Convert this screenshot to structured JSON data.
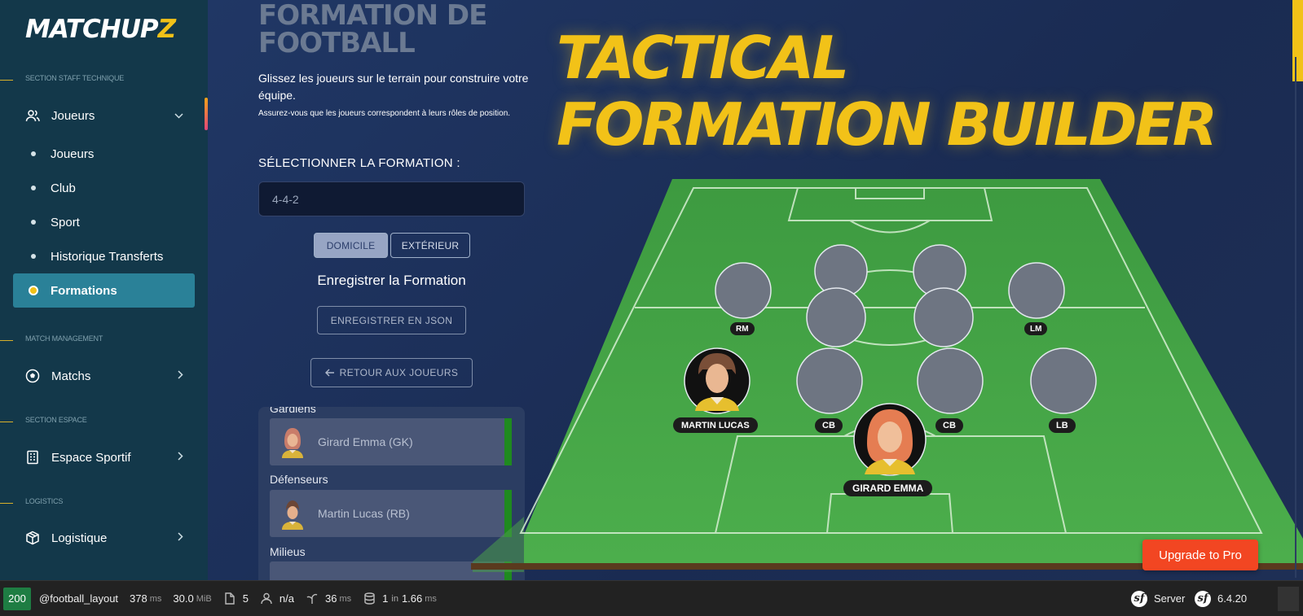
{
  "app": {
    "logo": "MATCHUP",
    "logo_accent": "Z"
  },
  "sidebar": {
    "sections": [
      {
        "label": "SECTION STAFF TECHNIQUE"
      },
      {
        "label": "MATCH MANAGEMENT"
      },
      {
        "label": "SECTION ESPACE"
      },
      {
        "label": "LOGISTICS"
      }
    ],
    "joueurs": {
      "label": "Joueurs",
      "icon": "users-icon"
    },
    "sub_items": [
      {
        "label": "Joueurs"
      },
      {
        "label": "Club"
      },
      {
        "label": "Sport"
      },
      {
        "label": "Historique Transferts"
      },
      {
        "label": "Formations"
      }
    ],
    "matchs": {
      "label": "Matchs",
      "icon": "soccer-ball-icon"
    },
    "espace": {
      "label": "Espace Sportif",
      "icon": "building-icon"
    },
    "logistique": {
      "label": "Logistique",
      "icon": "box-icon"
    }
  },
  "panel": {
    "title": "FORMATION DE FOOTBALL",
    "instructions": "Glissez les joueurs sur le terrain pour construire votre équipe.",
    "instructions_small": "Assurez-vous que les joueurs correspondent à leurs rôles de position.",
    "select_label": "SÉLECTIONNER LA FORMATION :",
    "selected_formation": "4-4-2",
    "home_label": "DOMICILE",
    "away_label": "EXTÉRIEUR",
    "save_title": "Enregistrer la Formation",
    "save_json_label": "ENREGISTRER EN JSON",
    "back_label": "RETOUR AUX JOUEURS",
    "groups": [
      {
        "label": "Gardiens",
        "players": [
          {
            "name": "Girard Emma (GK)",
            "avatar": "female-avatar"
          }
        ]
      },
      {
        "label": "Défenseurs",
        "players": [
          {
            "name": "Martin Lucas (RB)",
            "avatar": "male-avatar"
          }
        ]
      },
      {
        "label": "Milieus"
      }
    ]
  },
  "hero": {
    "line1": "TACTICAL",
    "line2": "FORMATION BUILDER"
  },
  "pitch": {
    "midfield": [
      {
        "label": "RM"
      },
      {
        "label": "LM"
      }
    ],
    "defence": [
      {
        "label": "MARTIN LUCAS",
        "avatar": "male-avatar"
      },
      {
        "label": "CB"
      },
      {
        "label": "CB"
      },
      {
        "label": "LB"
      }
    ],
    "goalkeeper": {
      "label": "GIRARD EMMA",
      "avatar": "female-avatar"
    }
  },
  "upgrade_label": "Upgrade to Pro",
  "toolbar": {
    "status": "200",
    "route": "@football_layout",
    "time": "378",
    "time_unit": "ms",
    "memory": "30.0",
    "memory_unit": "MiB",
    "logs": "5",
    "user": "n/a",
    "render": "36",
    "render_unit": "ms",
    "db_queries": "1",
    "db_in": "in",
    "db_time": "1.66",
    "db_unit": "ms",
    "server": "Server",
    "version": "6.4.20"
  },
  "colors": {
    "accent": "#f2c218",
    "sidebar_bg": "#13384a",
    "active_item": "#2a8198",
    "pitch_green": "#43a646",
    "upgrade": "#f24622"
  }
}
